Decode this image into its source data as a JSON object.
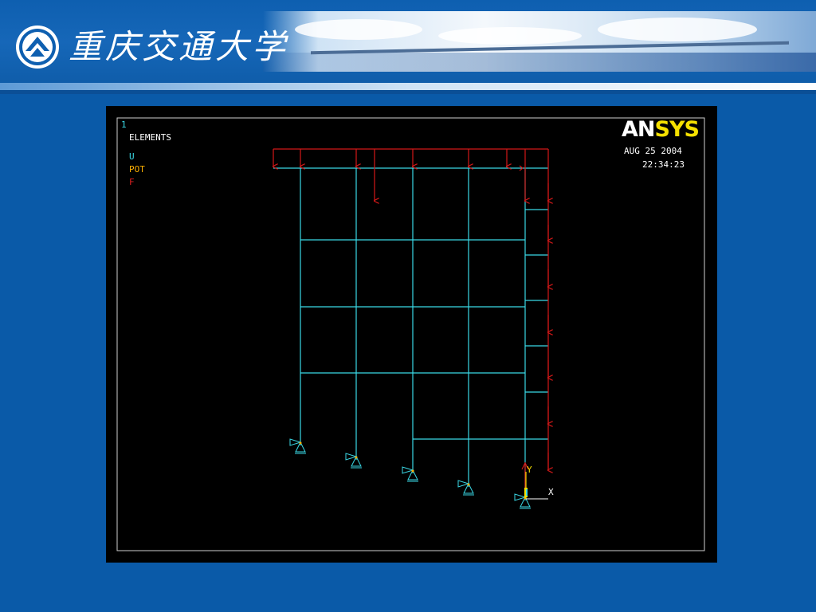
{
  "header": {
    "university_name": "重庆交通大学",
    "logo_icon": "university-seal-icon"
  },
  "ansys": {
    "window_number": "1",
    "plot_type": "ELEMENTS",
    "legend": [
      {
        "label": "U",
        "color": "#3ad9e6"
      },
      {
        "label": "POT",
        "color": "#ffb000"
      },
      {
        "label": "F",
        "color": "#e02020"
      }
    ],
    "logo": {
      "an": "AN",
      "sys": "SYS"
    },
    "date": "AUG 25 2004",
    "time": "22:34:23",
    "axis": {
      "y": "Y",
      "x": "X"
    },
    "colors": {
      "elements": "#3ad9e6",
      "force": "#d41818",
      "background": "#000000",
      "border": "#cfcfcf"
    }
  }
}
